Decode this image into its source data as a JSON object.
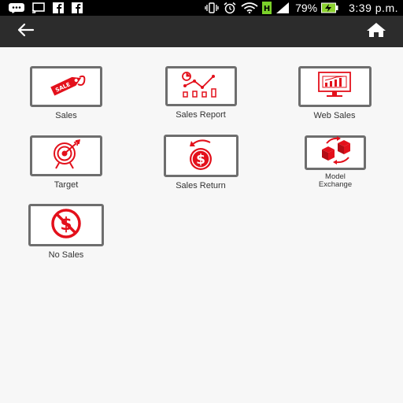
{
  "status_bar": {
    "battery_percent": "79%",
    "time": "3:39 p.m.",
    "icons": [
      "bbm-icon",
      "cast-icon",
      "facebook-icon",
      "facebook-icon",
      "vibrate-icon",
      "alarm-icon",
      "wifi-icon",
      "network-h-icon",
      "signal-icon",
      "battery-charging-icon"
    ]
  },
  "toolbar": {
    "back_icon": "arrow-left-icon",
    "home_icon": "home-icon",
    "background": "#2c2c2c"
  },
  "menu": {
    "accent_color": "#e3101b",
    "items": [
      {
        "label": "Sales",
        "icon": "sale-tag-icon"
      },
      {
        "label": "Sales Report",
        "icon": "chart-report-icon"
      },
      {
        "label": "Web Sales",
        "icon": "monitor-chart-icon"
      },
      {
        "label": "Target",
        "icon": "target-icon"
      },
      {
        "label": "Sales Return",
        "icon": "dollar-return-icon"
      },
      {
        "label": "Model\nExchange",
        "label_line1": "Model",
        "label_line2": "Exchange",
        "icon": "cube-exchange-icon"
      },
      {
        "label": "No Sales",
        "icon": "no-dollar-icon"
      }
    ]
  }
}
